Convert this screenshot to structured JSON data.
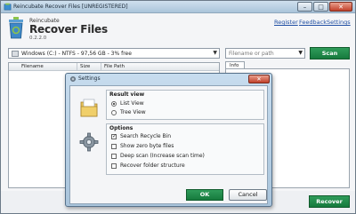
{
  "window": {
    "title": "Reincubate Recover Files [UNREGISTERED]"
  },
  "header": {
    "brand_small": "Reincubate",
    "brand_big": "Recover Files",
    "version": "0.2.2.0",
    "links": [
      "Register",
      "Feedback",
      "Settings"
    ]
  },
  "drive": {
    "selected": "Windows (C:) - NTFS - 97,56 GB - 3% free"
  },
  "filter": {
    "placeholder": "Filename or path"
  },
  "buttons": {
    "scan": "Scan",
    "recover": "Recover"
  },
  "filelist": {
    "columns": [
      "Filename",
      "Size",
      "File Path"
    ]
  },
  "info": {
    "tab_label": "Info"
  },
  "dialog": {
    "title": "Settings",
    "result_view": {
      "title": "Result view",
      "options": [
        "List View",
        "Tree View"
      ],
      "selected_index": 0
    },
    "options": {
      "title": "Options",
      "items": [
        {
          "label": "Search Recycle Bin",
          "checked": true
        },
        {
          "label": "Show zero byte files",
          "checked": false
        },
        {
          "label": "Deep scan (Increase scan time)",
          "checked": false
        },
        {
          "label": "Recover folder structure",
          "checked": false
        }
      ]
    },
    "ok": "OK",
    "cancel": "Cancel"
  },
  "colors": {
    "accent_green": "#1e8a4a",
    "titlebar": "#b8cfe3"
  }
}
